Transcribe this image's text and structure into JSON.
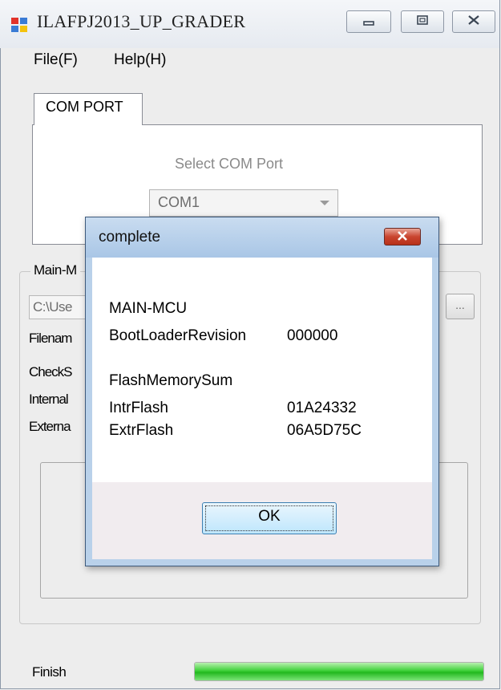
{
  "window": {
    "title": "ILAFPJ2013_UP_GRADER",
    "menu": {
      "file": "File(F)",
      "help": "Help(H)"
    }
  },
  "com_tab": {
    "tab_label": "COM PORT",
    "select_label": "Select COM Port",
    "port_value": "COM1"
  },
  "group": {
    "title_partial": "Main-M",
    "path_partial": "C:\\Use",
    "browse_label": "...",
    "labels": [
      "Filenam",
      "CheckS",
      "Internal",
      "Externa"
    ]
  },
  "status": {
    "label": "Finish",
    "progress": 1.0
  },
  "dialog": {
    "title": "complete",
    "heading": "MAIN-MCU",
    "bootloader_label": "BootLoaderRevision",
    "bootloader_value": "000000",
    "flash_heading": "FlashMemorySum",
    "intr_label": "IntrFlash",
    "intr_value": "01A24332",
    "extr_label": "ExtrFlash",
    "extr_value": "06A5D75C",
    "ok_label": "OK"
  },
  "icons": [
    "app-icon",
    "minimize-icon",
    "maximize-icon",
    "close-icon",
    "dropdown-arrow-icon",
    "dialog-close-icon"
  ],
  "colors": {
    "progress_fill": "#2fc52a",
    "dialog_close": "#c9452f",
    "title_bar": "#dfe6ef"
  }
}
